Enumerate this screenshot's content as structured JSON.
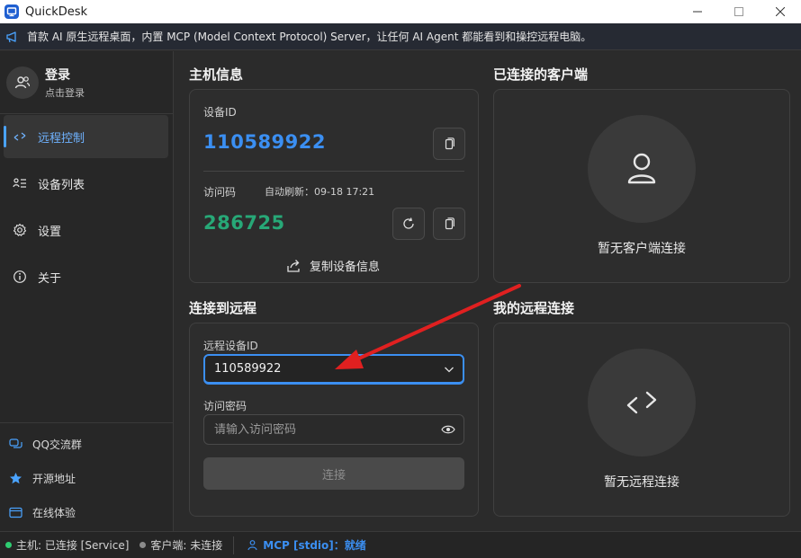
{
  "window": {
    "title": "QuickDesk",
    "controls": {
      "minimize": "—",
      "maximize": "☐",
      "close": "✕"
    }
  },
  "banner": {
    "icon": "megaphone-icon",
    "text": "首款 AI 原生远程桌面，内置 MCP (Model Context Protocol) Server，让任何 AI Agent 都能看到和操控远程电脑。"
  },
  "sidebar": {
    "login": {
      "title": "登录",
      "subtitle": "点击登录"
    },
    "nav": [
      {
        "label": "远程控制",
        "icon": "remote-control-icon",
        "active": true
      },
      {
        "label": "设备列表",
        "icon": "device-list-icon",
        "active": false
      },
      {
        "label": "设置",
        "icon": "gear-icon",
        "active": false
      },
      {
        "label": "关于",
        "icon": "info-icon",
        "active": false
      }
    ],
    "links": [
      {
        "label": "QQ交流群",
        "icon": "chat-group-icon"
      },
      {
        "label": "开源地址",
        "icon": "star-icon"
      },
      {
        "label": "在线体验",
        "icon": "browser-icon"
      }
    ]
  },
  "host": {
    "section_title": "主机信息",
    "device_id_label": "设备ID",
    "device_id": "110589922",
    "access_code_label": "访问码",
    "auto_refresh": "自动刷新：09-18 17:21",
    "access_code": "286725",
    "copy_label": "复制设备信息"
  },
  "clients": {
    "section_title": "已连接的客户端",
    "empty_text": "暂无客户端连接"
  },
  "connect": {
    "section_title": "连接到远程",
    "remote_id_label": "远程设备ID",
    "remote_id_value": "110589922",
    "password_label": "访问密码",
    "password_placeholder": "请输入访问密码",
    "button_label": "连接"
  },
  "remote": {
    "section_title": "我的远程连接",
    "empty_text": "暂无远程连接"
  },
  "status": {
    "host": "主机: 已连接 [Service]",
    "client": "客户端: 未连接",
    "mcp": "MCP [stdio]：就绪"
  },
  "colors": {
    "accent": "#3b8ff2",
    "code_green": "#27a877",
    "status_green": "#2ecc71",
    "status_grey": "#8a8a8a",
    "annotation_red": "#e02020"
  }
}
